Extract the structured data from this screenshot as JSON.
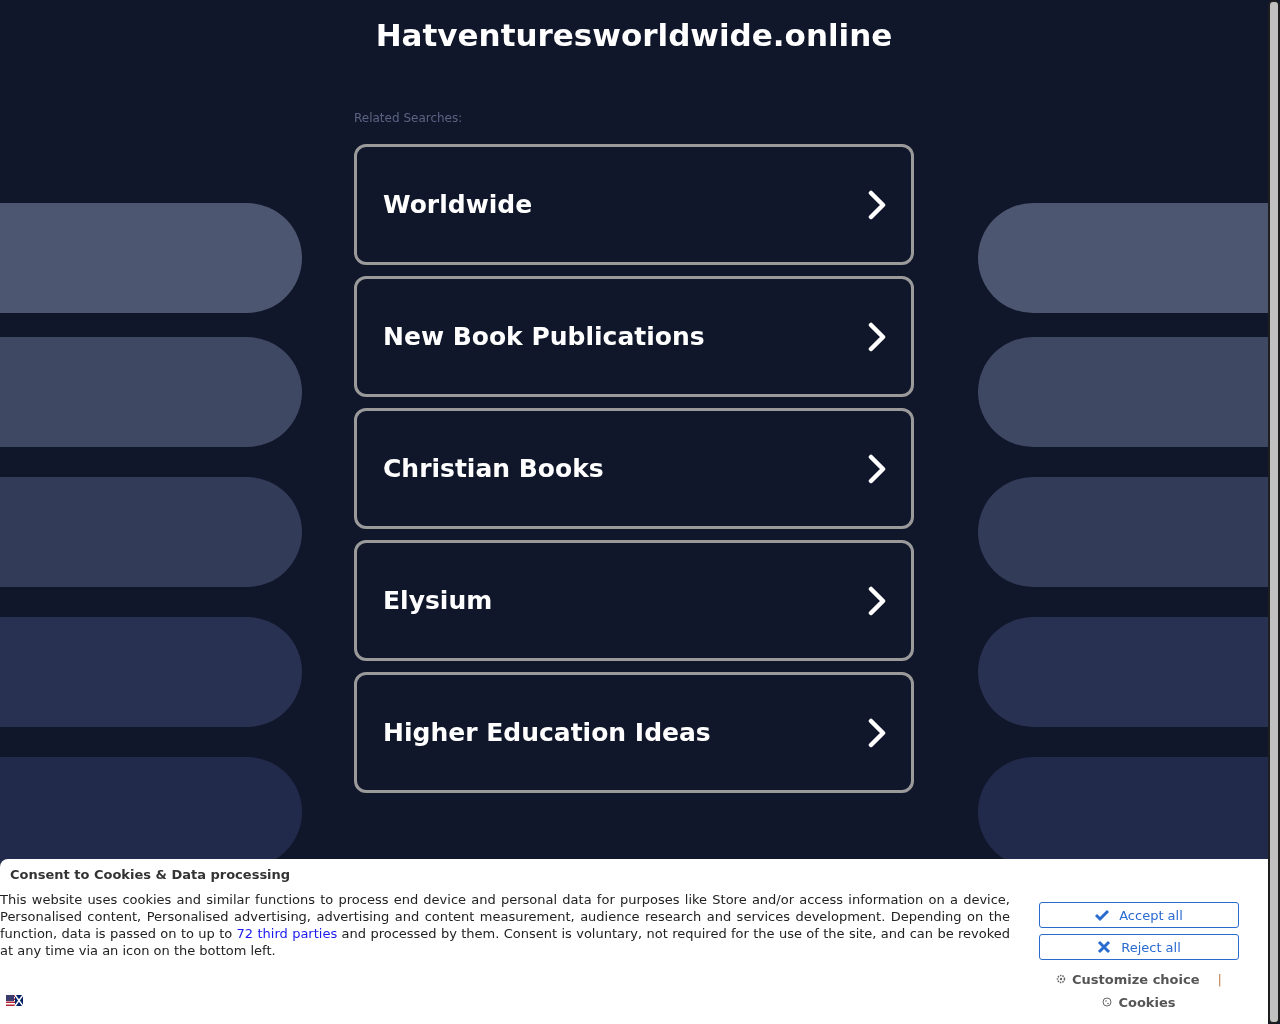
{
  "site_title": "Hatventuresworldwide.online",
  "related_label": "Related Searches:",
  "links": [
    {
      "label": "Worldwide"
    },
    {
      "label": "New Book Publications"
    },
    {
      "label": "Christian Books"
    },
    {
      "label": "Elysium"
    },
    {
      "label": "Higher Education Ideas"
    }
  ],
  "consent": {
    "title": "Consent to Cookies & Data processing",
    "text_before": "This website uses cookies and similar functions to process end device and personal data for purposes like Store and/or access information on a device, Personalised content, Personalised advertising, advertising and content measurement, audience research and services development. Depending on the function, data is passed on to up to ",
    "link": "72 third parties",
    "text_after": " and processed by them. Consent is voluntary, not required for the use of the site, and can be revoked at any time via an icon on the bottom left.",
    "accept": "Accept all",
    "reject": "Reject all",
    "customize": "Customize choice",
    "separator": "|",
    "cookies": "Cookies"
  }
}
